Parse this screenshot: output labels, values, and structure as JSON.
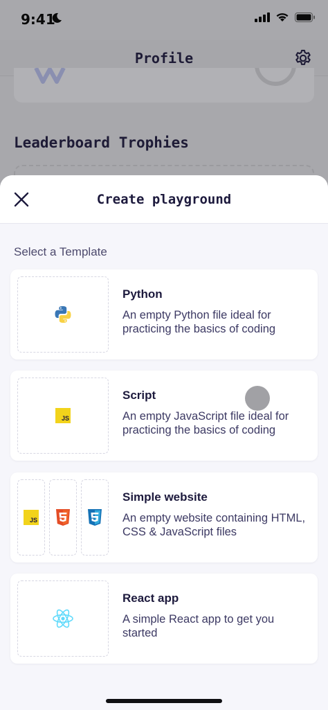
{
  "status_bar": {
    "time": "9:41"
  },
  "background": {
    "nav_title": "Profile",
    "section_title": "Leaderboard Trophies"
  },
  "sheet": {
    "title": "Create playground",
    "section_label": "Select a Template",
    "templates": [
      {
        "name": "Python",
        "description": "An empty Python file ideal for practicing the basics of coding",
        "icon": "python-icon"
      },
      {
        "name": "Script",
        "description": "An empty JavaScript file ideal for practicing the basics of coding",
        "icon": "javascript-icon",
        "badge": "JS"
      },
      {
        "name": "Simple website",
        "description": "An empty website containing HTML, CSS & JavaScript files",
        "icons": [
          "javascript-icon",
          "html5-icon",
          "css3-icon"
        ],
        "badge": "JS"
      },
      {
        "name": "React app",
        "description": "A simple React app to get you started",
        "icon": "react-icon"
      }
    ]
  },
  "colors": {
    "accent_text": "#1d1a3d",
    "sheet_bg": "#f6f6fb",
    "js_yellow": "#f2d31b",
    "html_red": "#e44d26",
    "css_blue": "#1e8fd8",
    "react_cyan": "#61dafb"
  }
}
